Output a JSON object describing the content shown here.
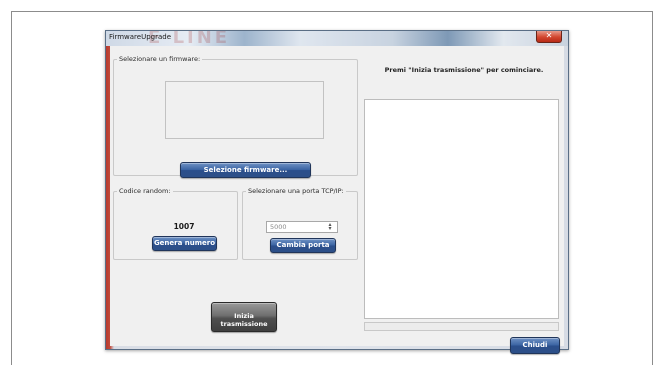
{
  "window": {
    "title": "FirmwareUpgrade",
    "close_glyph": "✕"
  },
  "firmware_group": {
    "legend": "Selezionare un firmware:",
    "select_button": "Selezione firmware..."
  },
  "random_group": {
    "legend": "Codice random:",
    "value": "1007",
    "generate_button": "Genera numero"
  },
  "port_group": {
    "legend": "Selezionare una porta TCP/IP:",
    "port_value": "5000",
    "change_button": "Cambia porta"
  },
  "transmission": {
    "prompt": "Premi \"Inizia trasmissione\" per cominciare.",
    "start_button_line1": "Inizia",
    "start_button_line2": "trasmissione",
    "close_button": "Chiudi"
  },
  "icons": {
    "spin": "spin-up-down-icon",
    "close": "close-icon"
  },
  "colors": {
    "button_blue": "#3b64a3",
    "button_dark": "#555555",
    "close_red": "#d2462f",
    "client_bg": "#f0f0f0"
  }
}
